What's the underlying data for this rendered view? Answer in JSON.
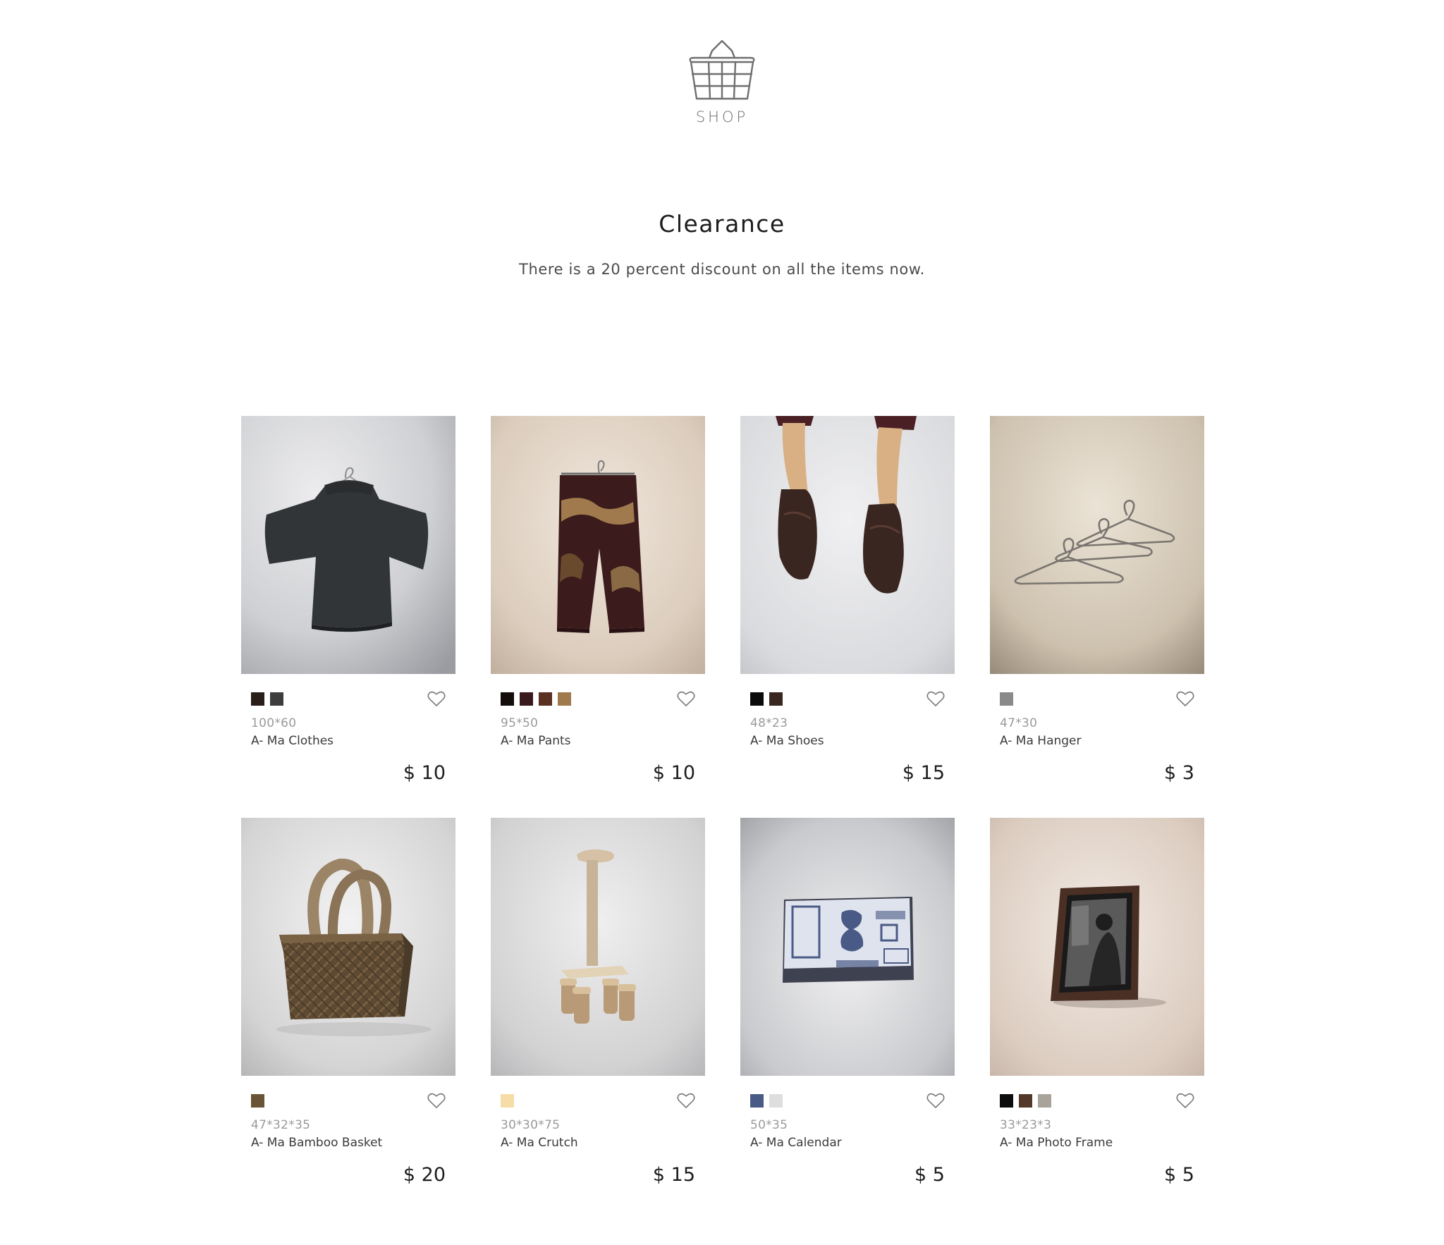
{
  "header": {
    "logo_icon": "shopping-basket-icon",
    "logo_label": "SHOP"
  },
  "section": {
    "title": "Clearance",
    "subtitle": "There is a 20 percent discount on all the items now."
  },
  "products": [
    {
      "image": "knitted-sweater-on-hanger",
      "colors": [
        "#2a1e19",
        "#3d3d3d"
      ],
      "dimensions": "100*60",
      "name": "A- Ma Clothes",
      "price": "$ 10",
      "favorite_icon": "heart-outline-icon"
    },
    {
      "image": "knitted-pants-on-hanger",
      "colors": [
        "#140d0b",
        "#3a1a1c",
        "#5a3021",
        "#a07a4c"
      ],
      "dimensions": "95*50",
      "name": "A- Ma Pants",
      "price": "$ 10",
      "favorite_icon": "heart-outline-icon"
    },
    {
      "image": "leather-shoes-on-feet",
      "colors": [
        "#0b0b0b",
        "#3a2720"
      ],
      "dimensions": "48*23",
      "name": "A- Ma Shoes",
      "price": "$ 15",
      "favorite_icon": "heart-outline-icon"
    },
    {
      "image": "wire-hangers",
      "colors": [
        "#8a8a8a"
      ],
      "dimensions": "47*30",
      "name": "A- Ma Hanger",
      "price": "$ 3",
      "favorite_icon": "heart-outline-icon"
    },
    {
      "image": "woven-bamboo-basket",
      "colors": [
        "#6b5435"
      ],
      "dimensions": "47*32*35",
      "name": "A- Ma Bamboo Basket",
      "price": "$ 20",
      "favorite_icon": "heart-outline-icon"
    },
    {
      "image": "wooden-crutch",
      "colors": [
        "#f6dca6"
      ],
      "dimensions": "30*30*75",
      "name": "A- Ma Crutch",
      "price": "$ 15",
      "favorite_icon": "heart-outline-icon"
    },
    {
      "image": "tear-off-calendar",
      "colors": [
        "#4a5a86",
        "#dedede"
      ],
      "dimensions": "50*35",
      "name": "A- Ma Calendar",
      "price": "$ 5",
      "favorite_icon": "heart-outline-icon"
    },
    {
      "image": "photo-frame",
      "colors": [
        "#0d0d0d",
        "#54392a",
        "#aaa39c"
      ],
      "dimensions": "33*23*3",
      "name": "A- Ma Photo Frame",
      "price": "$ 5",
      "favorite_icon": "heart-outline-icon"
    }
  ]
}
